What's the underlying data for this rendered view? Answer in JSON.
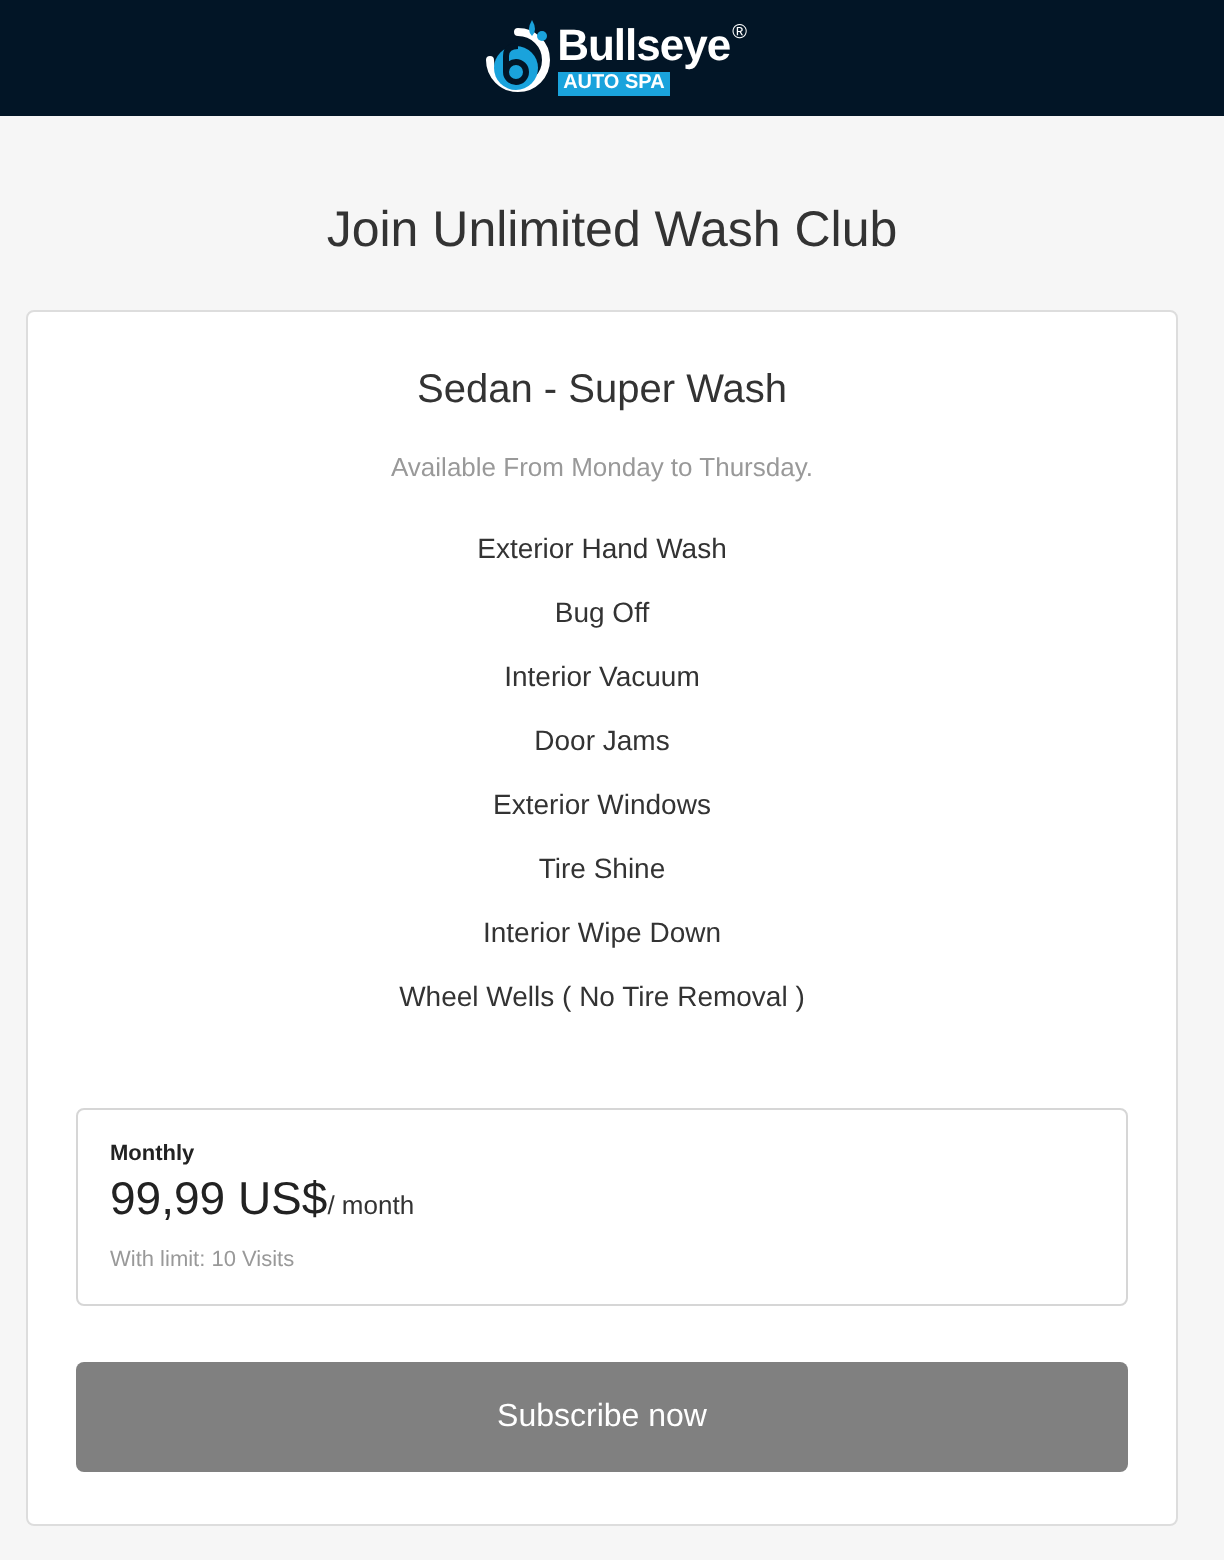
{
  "header": {
    "logo": {
      "name": "Bullseye",
      "registered": "®",
      "tagline": "AUTO SPA"
    }
  },
  "page_title": "Join Unlimited Wash Club",
  "plan": {
    "title": "Sedan - Super Wash",
    "availability": "Available From Monday to Thursday.",
    "features": [
      "Exterior Hand Wash",
      "Bug Off",
      "Interior Vacuum",
      "Door Jams",
      "Exterior Windows",
      "Tire Shine",
      "Interior Wipe Down",
      "Wheel Wells ( No Tire Removal )"
    ],
    "pricing": {
      "period": "Monthly",
      "price": "99,99 US$",
      "unit": "/ month",
      "limit": "With limit: 10 Visits"
    },
    "button": "Subscribe now"
  }
}
